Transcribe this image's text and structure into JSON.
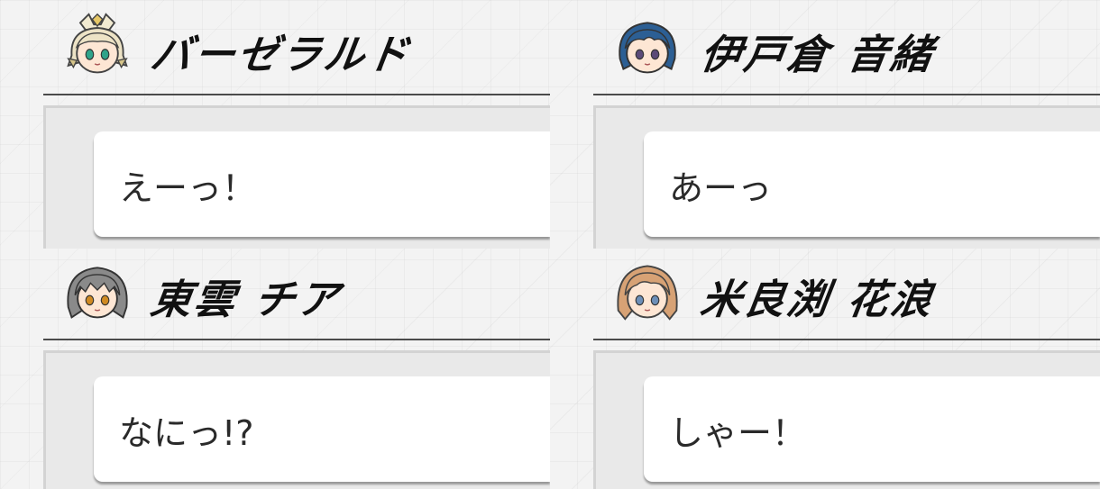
{
  "panels": [
    {
      "avatar_icon": "barzelald-avatar-icon",
      "name": "バーゼラルド",
      "line": "えーっ！"
    },
    {
      "avatar_icon": "ikura-ao-avatar-icon",
      "name": "伊戸倉 音緒",
      "line": "あーっ"
    },
    {
      "avatar_icon": "shinonome-chia-avatar-icon",
      "name": "東雲 チア",
      "line": "なにっ!?"
    },
    {
      "avatar_icon": "yorafuchi-karen-avatar-icon",
      "name": "米良渕 花浪",
      "line": "しゃー！"
    }
  ],
  "colors": {
    "background": "#f3f3f3",
    "rule": "#4b4b4b",
    "box_area": "#e9e9e9",
    "speech_box": "#ffffff",
    "name_text": "#111111",
    "speech_text": "#2a2a2a"
  }
}
